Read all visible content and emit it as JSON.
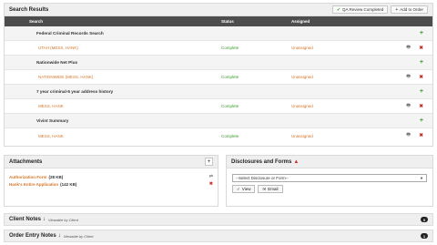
{
  "search": {
    "title": "Search Results",
    "qa_label": "QA Review Completed",
    "add_label": "Add to Order",
    "columns": [
      "Search",
      "Status",
      "Assigned"
    ],
    "groups": [
      {
        "name": "Federal Criminal Records Search",
        "item": {
          "name": "UTAH (MESS, HANK)",
          "status": "Complete",
          "assigned": "Unassigned"
        }
      },
      {
        "name": "Nationwide Net Plus",
        "item": {
          "name": "NATIONWIDE (MESS, HANK)",
          "status": "Complete",
          "assigned": "Unassigned"
        }
      },
      {
        "name": "7 year criminal-5 year address history",
        "item": {
          "name": "MESS, HANK",
          "status": "Complete",
          "assigned": "Unassigned"
        }
      },
      {
        "name": "Vivint Summary",
        "item": {
          "name": "MESS, HANK",
          "status": "Complete",
          "assigned": "Unassigned"
        }
      }
    ]
  },
  "attachments": {
    "title": "Attachments",
    "add": "+",
    "files": [
      {
        "name": "Authorization Form",
        "size": "(28 KB)"
      },
      {
        "name": "Hank's Entire Application",
        "size": "(142 KB)"
      }
    ]
  },
  "disclosures": {
    "title": "Disclosures and Forms",
    "select_value": "--Select Disclosure or Form--",
    "view_label": "View",
    "email_label": "Email"
  },
  "client_notes": {
    "title": "Client Notes",
    "sub": "Viewable by Client",
    "count": "0"
  },
  "order_notes": {
    "title": "Order Entry Notes",
    "sub": "Viewable by Client",
    "count": "1"
  },
  "colors": {
    "accent_orange": "#d3762a",
    "status_green": "#3d9a2f",
    "delete_red": "#c9302c",
    "table_header": "#4d4d4d"
  }
}
